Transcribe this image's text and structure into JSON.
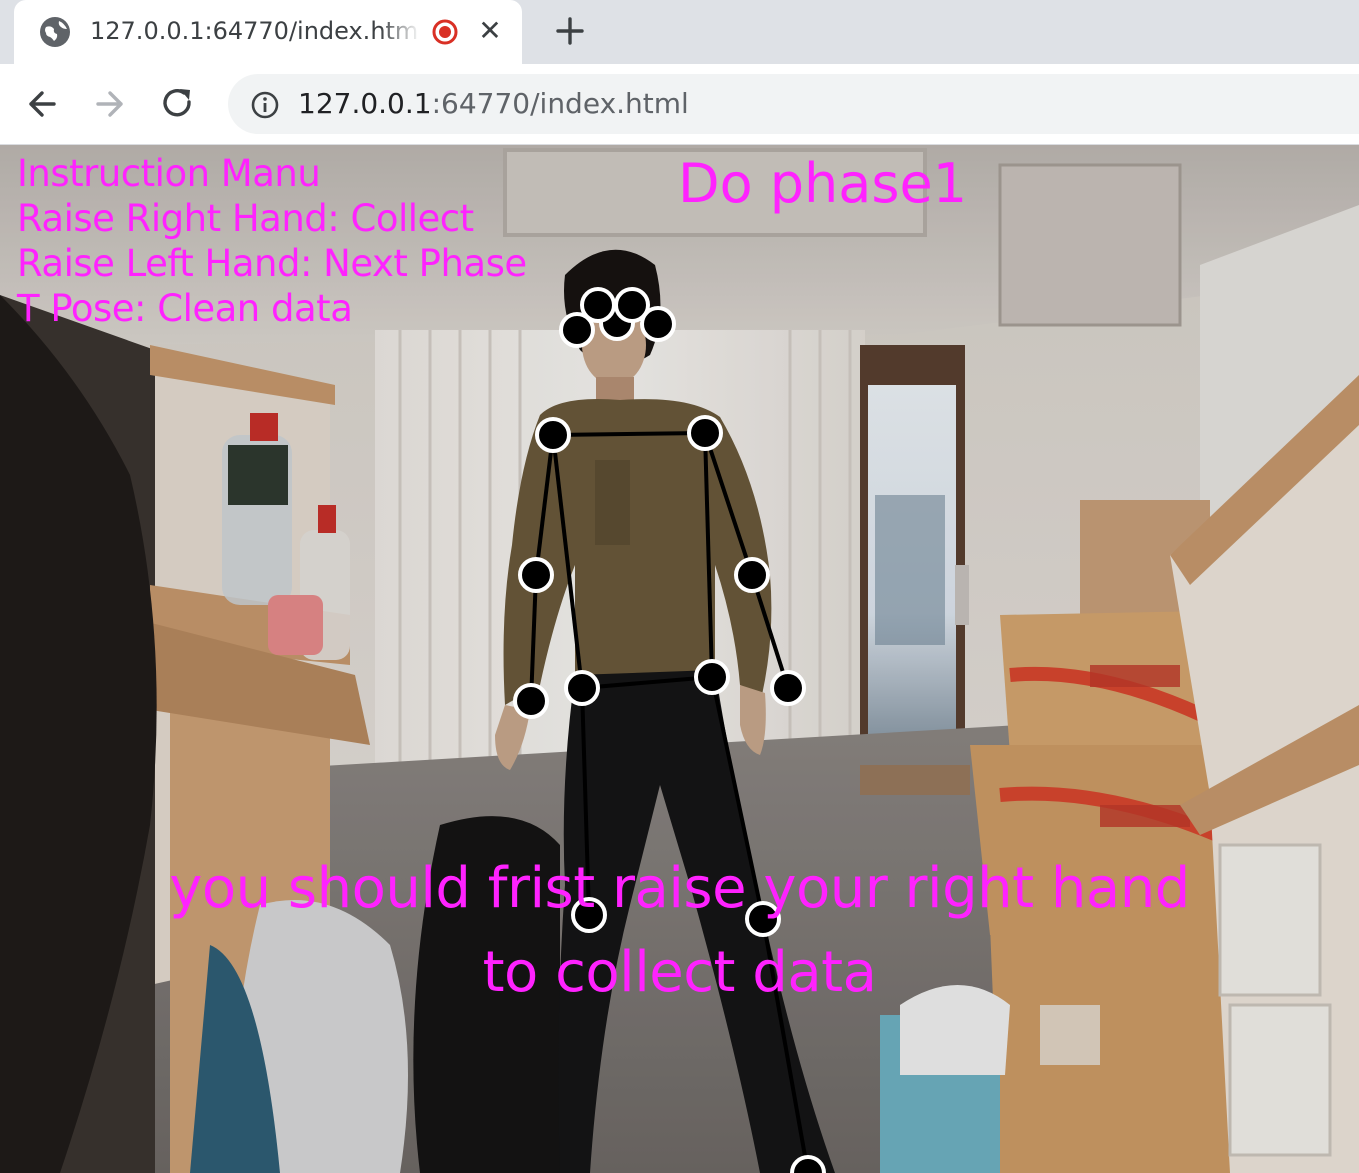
{
  "browser": {
    "tab_title": "127.0.0.1:64770/index.html",
    "new_tab_label": "+",
    "close_label": "✕",
    "url_host": "127.0.0.1",
    "url_path": ":64770/index.html",
    "icons": [
      "globe-icon",
      "recording-icon",
      "close-icon",
      "new-tab-icon",
      "back-icon",
      "forward-icon",
      "reload-icon",
      "info-icon"
    ]
  },
  "app": {
    "instructions": {
      "heading": "Instruction Manu",
      "items": [
        "Raise Right Hand: Collect",
        "Raise Left Hand: Next Phase",
        "T Pose: Clean data"
      ]
    },
    "phase_title": "Do phase1",
    "guide_lines": [
      "you should frist raise your right hand",
      "to collect data"
    ],
    "colors": {
      "overlay_text": "#ff22ff",
      "keypoint_fill": "#000000",
      "keypoint_stroke": "#ffffff",
      "skeleton_line": "#000000",
      "recording_dot": "#d93025"
    }
  }
}
